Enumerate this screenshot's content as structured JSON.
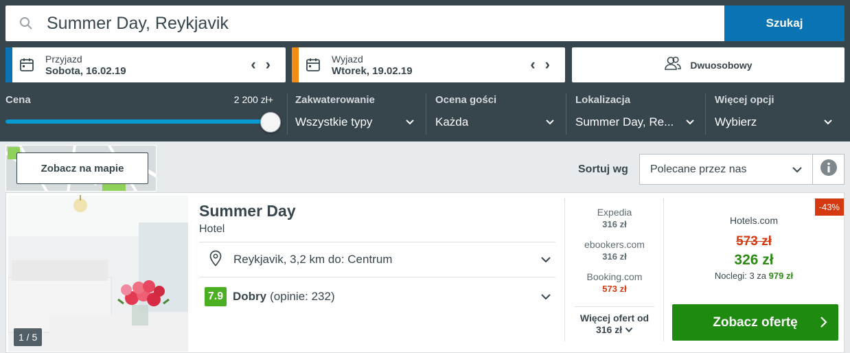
{
  "search": {
    "query": "Summer Day, Reykjavik",
    "button_label": "Szukaj"
  },
  "checkin": {
    "label": "Przyjazd",
    "value": "Sobota, 16.02.19",
    "stripe_color": "#0a73b4"
  },
  "checkout": {
    "label": "Wyjazd",
    "value": "Wtorek, 19.02.19",
    "stripe_color": "#f48b12"
  },
  "room": {
    "label": "Dwuosobowy"
  },
  "filters": {
    "price": {
      "title": "Cena",
      "max_label": "2 200 zł+",
      "level_percent": 100
    },
    "accommodation": {
      "title": "Zakwaterowanie",
      "value": "Wszystkie typy"
    },
    "rating": {
      "title": "Ocena gości",
      "value": "Każda"
    },
    "location": {
      "title": "Lokalizacja",
      "value": "Summer Day, Re..."
    },
    "more": {
      "title": "Więcej opcji",
      "value": "Wybierz"
    }
  },
  "map": {
    "button_label": "Zobacz na mapie"
  },
  "sort": {
    "label": "Sortuj wg",
    "value": "Polecane przez nas"
  },
  "hotel": {
    "name": "Summer Day",
    "type": "Hotel",
    "photo_counter": "1 / 5",
    "location": "Reykjavik, 3,2 km do: Centrum",
    "rating_score": "7.9",
    "rating_label": "Dobry",
    "rating_count": "(opinie: 232)",
    "providers": [
      {
        "name": "Expedia",
        "price": "316 zł",
        "color": "#5d6a71"
      },
      {
        "name": "ebookers.com",
        "price": "316 zł",
        "color": "#5d6a71"
      },
      {
        "name": "Booking.com",
        "price": "573 zł",
        "color": "#d5390f"
      }
    ],
    "more_offers_line1": "Więcej ofert od",
    "more_offers_line2": "316 zł",
    "deal": {
      "discount": "-43%",
      "provider": "Hotels.com",
      "old_price": "573 zł",
      "new_price": "326 zł",
      "nights_text": "Noclegi: 3 za",
      "nights_total": "979 zł",
      "cta_label": "Zobacz ofertę"
    }
  },
  "colors": {
    "header_bg": "#37454d",
    "accent_blue": "#0a73b4",
    "cta_green": "#1f8a10",
    "price_green": "#2c8a14",
    "discount_red": "#d5390f",
    "rating_green": "#4caf22"
  }
}
